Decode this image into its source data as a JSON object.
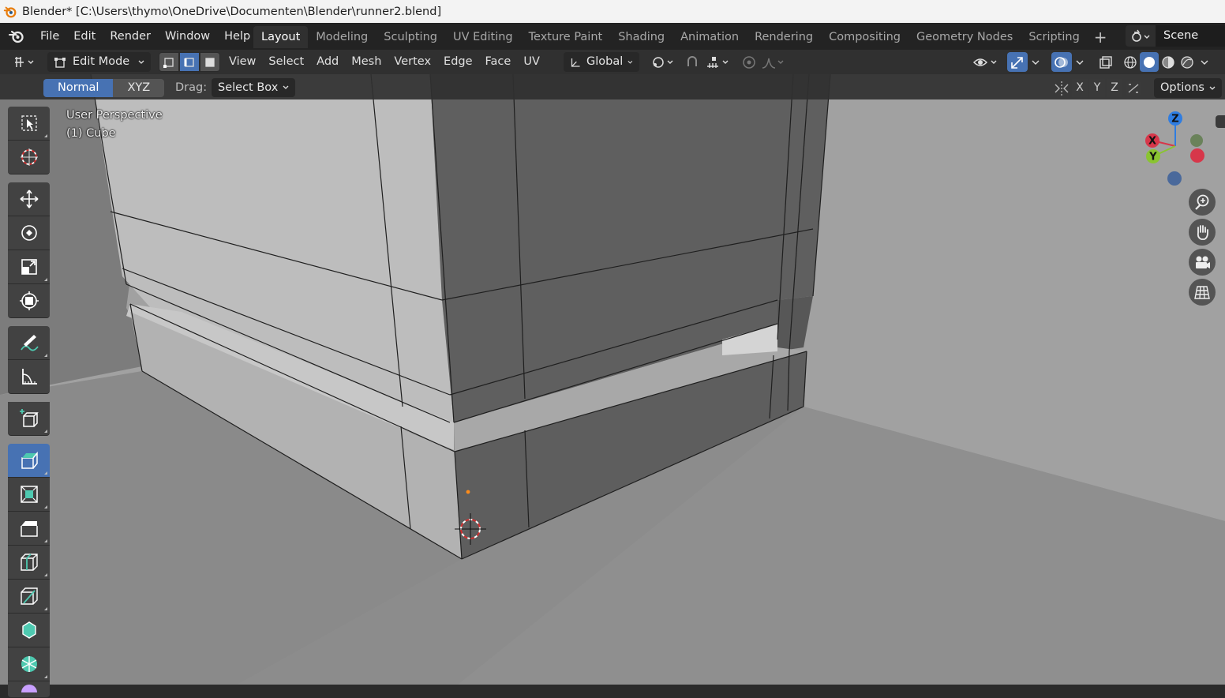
{
  "window": {
    "title": "Blender* [C:\\Users\\thymo\\OneDrive\\Documenten\\Blender\\runner2.blend]"
  },
  "menubar": {
    "items": [
      "File",
      "Edit",
      "Render",
      "Window",
      "Help"
    ]
  },
  "workspaces": {
    "tabs": [
      "Layout",
      "Modeling",
      "Sculpting",
      "UV Editing",
      "Texture Paint",
      "Shading",
      "Animation",
      "Rendering",
      "Compositing",
      "Geometry Nodes",
      "Scripting"
    ],
    "active": "Layout"
  },
  "scene": {
    "name": "Scene"
  },
  "viewport_header": {
    "mode": "Edit Mode",
    "menus": [
      "View",
      "Select",
      "Add",
      "Mesh",
      "Vertex",
      "Edge",
      "Face",
      "UV"
    ],
    "transform_orientation": "Global",
    "select_mode_active": "edge"
  },
  "tool_settings": {
    "orientation_options": [
      "Normal",
      "XYZ"
    ],
    "orientation_active": "Normal",
    "drag_label": "Drag:",
    "drag_value": "Select Box",
    "mirror_axes": [
      "X",
      "Y",
      "Z"
    ],
    "options_label": "Options"
  },
  "viewport": {
    "view_name": "User Perspective",
    "object_label": "(1) Cube"
  },
  "gizmo": {
    "axes": [
      "Z",
      "X",
      "Y"
    ]
  },
  "colors": {
    "accent": "#4772b3",
    "x_axis": "#d7374a",
    "y_axis": "#8ac431",
    "z_axis": "#2f7de1"
  },
  "icons": {
    "toolbar": [
      "select-box-icon",
      "cursor-icon",
      "move-icon",
      "rotate-icon",
      "scale-icon",
      "transform-icon",
      "annotate-icon",
      "measure-icon",
      "add-cube-icon",
      "extrude-region-icon",
      "inset-faces-icon",
      "bevel-icon",
      "loop-cut-icon",
      "knife-icon",
      "poly-build-icon",
      "spin-icon",
      "smooth-icon"
    ],
    "navigation": [
      "zoom-icon",
      "pan-hand-icon",
      "camera-icon",
      "ortho-grid-icon"
    ]
  }
}
